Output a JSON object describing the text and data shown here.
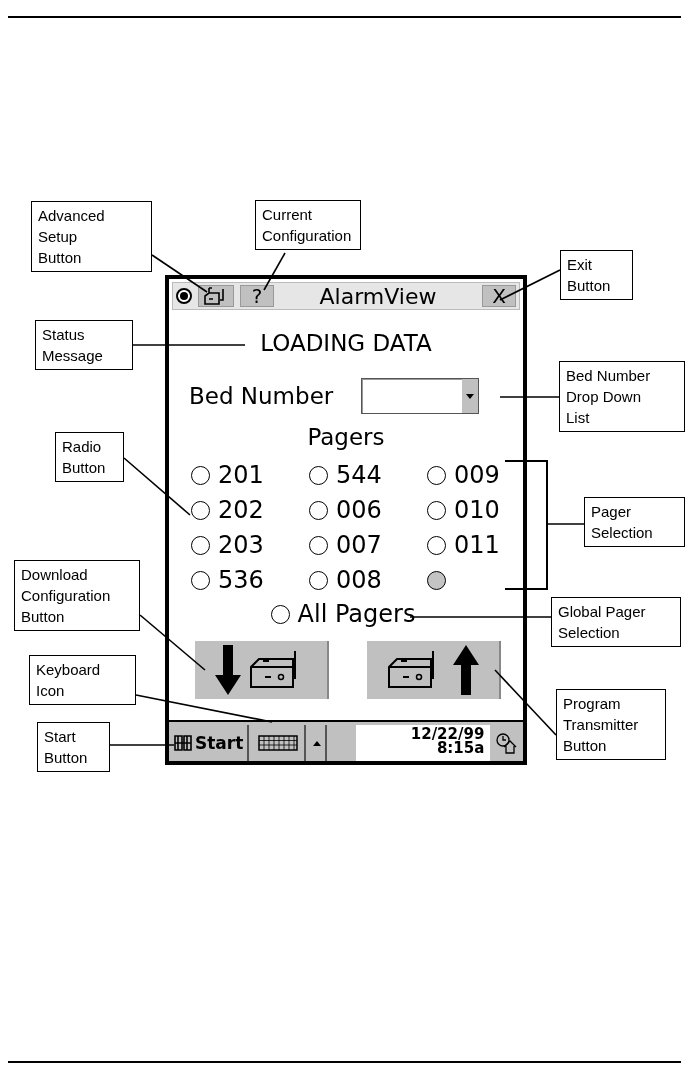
{
  "window": {
    "title": "AlarmView",
    "indicator": {
      "selected": true
    },
    "buttons": [
      {
        "kind": "setup"
      },
      {
        "kind": "text",
        "label": "?"
      }
    ],
    "close": {
      "label": "X"
    }
  },
  "status_message": "LOADING DATA",
  "bed_number": {
    "label": "Bed Number"
  },
  "pagers": {
    "heading": "Pagers",
    "items": [
      {
        "label": "201",
        "selected": false,
        "disabled": false
      },
      {
        "label": "544",
        "selected": false,
        "disabled": false
      },
      {
        "label": "009",
        "selected": false,
        "disabled": false
      },
      {
        "label": "202",
        "selected": false,
        "disabled": false
      },
      {
        "label": "006",
        "selected": false,
        "disabled": false
      },
      {
        "label": "010",
        "selected": false,
        "disabled": false
      },
      {
        "label": "203",
        "selected": false,
        "disabled": false
      },
      {
        "label": "007",
        "selected": false,
        "disabled": false
      },
      {
        "label": "011",
        "selected": false,
        "disabled": false
      },
      {
        "label": "536",
        "selected": false,
        "disabled": false
      },
      {
        "label": "008",
        "selected": false,
        "disabled": false
      },
      {
        "selected": false,
        "disabled": true
      }
    ],
    "all": {
      "label": "All Pagers",
      "selected": false
    }
  },
  "actions": [
    {
      "kind": "download"
    },
    {
      "kind": "program"
    }
  ],
  "taskbar": {
    "start": "Start",
    "date": "12/22/99",
    "time": "8:15a"
  },
  "callouts": [
    {
      "lines": [
        "Advanced",
        "Setup",
        "Button"
      ]
    },
    {
      "lines": [
        "Current",
        "Configuration"
      ]
    },
    {
      "lines": [
        "Exit",
        "Button"
      ]
    },
    {
      "lines": [
        "Status",
        "Message"
      ]
    },
    {
      "lines": [
        "Bed Number",
        "Drop Down",
        "List"
      ]
    },
    {
      "lines": [
        "Radio",
        "Button"
      ]
    },
    {
      "lines": [
        "Pager",
        "Selection"
      ]
    },
    {
      "lines": [
        "Download",
        "Configuration",
        "Button"
      ]
    },
    {
      "lines": [
        "Global Pager",
        "Selection"
      ]
    },
    {
      "lines": [
        "Keyboard",
        "Icon"
      ]
    },
    {
      "lines": [
        "Program",
        "Transmitter",
        "Button"
      ]
    },
    {
      "lines": [
        "Start",
        "Button"
      ]
    }
  ]
}
